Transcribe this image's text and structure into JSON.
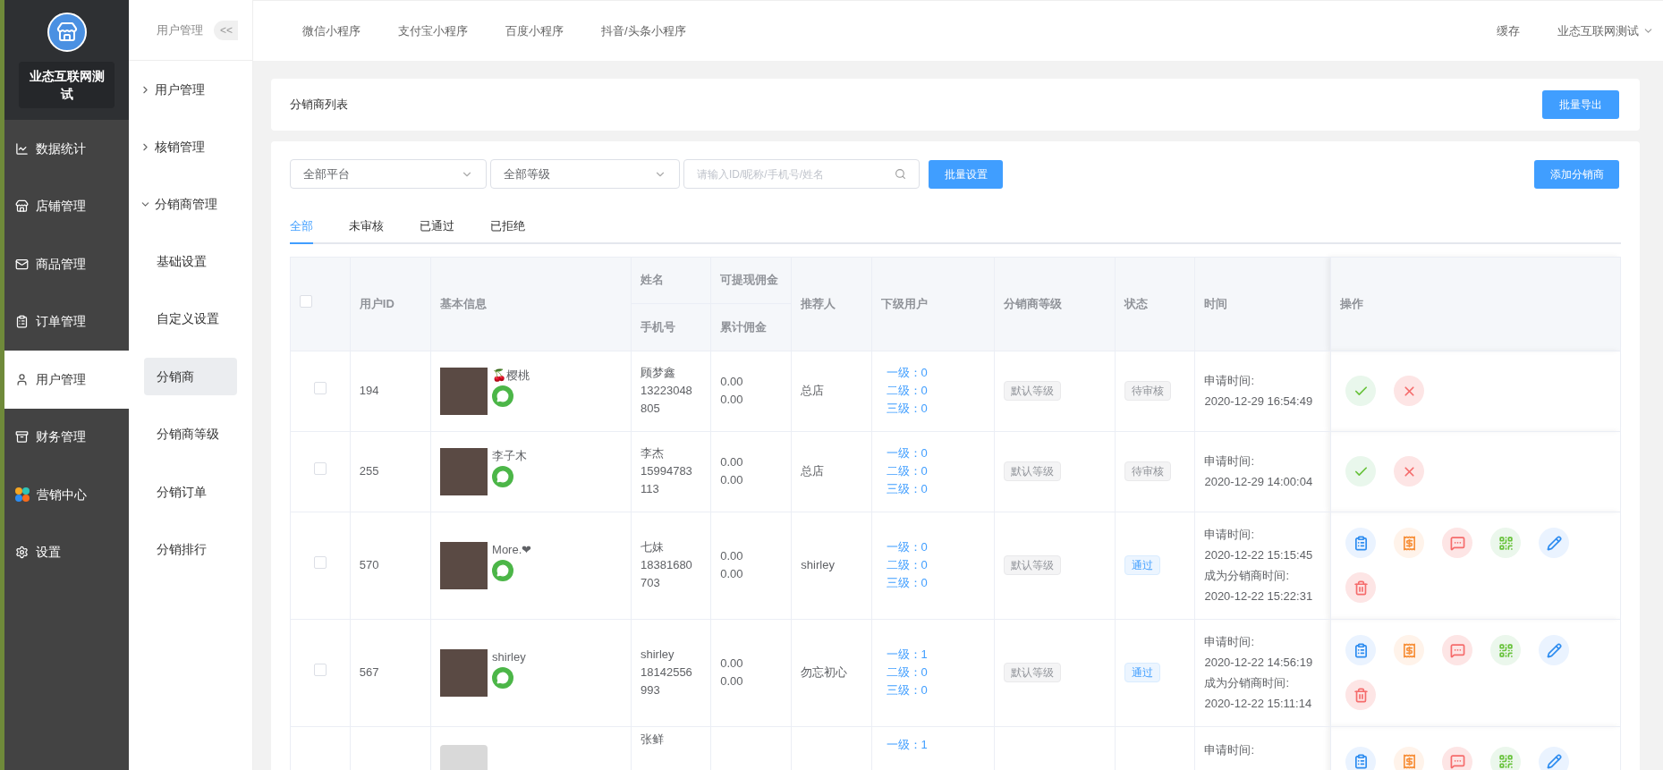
{
  "brand": {
    "name": "业态互联网测试"
  },
  "main_menu": [
    {
      "label": "数据统计",
      "selected": false
    },
    {
      "label": "店铺管理",
      "selected": false
    },
    {
      "label": "商品管理",
      "selected": false
    },
    {
      "label": "订单管理",
      "selected": false
    },
    {
      "label": "用户管理",
      "selected": true
    },
    {
      "label": "财务管理",
      "selected": false
    },
    {
      "label": "营销中心",
      "selected": false
    },
    {
      "label": "设置",
      "selected": false
    }
  ],
  "sub_header": {
    "title": "用户管理",
    "collapse": "<<"
  },
  "sub_menu": [
    {
      "label": "用户管理",
      "expanded": false
    },
    {
      "label": "核销管理",
      "expanded": false
    },
    {
      "label": "分销商管理",
      "expanded": true,
      "children": [
        {
          "label": "基础设置",
          "selected": false
        },
        {
          "label": "自定义设置",
          "selected": false
        },
        {
          "label": "分销商",
          "selected": true
        },
        {
          "label": "分销商等级",
          "selected": false
        },
        {
          "label": "分销订单",
          "selected": false
        },
        {
          "label": "分销排行",
          "selected": false
        }
      ]
    }
  ],
  "top_tabs": [
    "微信小程序",
    "支付宝小程序",
    "百度小程序",
    "抖音/头条小程序"
  ],
  "top_right": {
    "cache": "缓存",
    "user": "业态互联网测试"
  },
  "list_header": {
    "title": "分销商列表",
    "export_button": "批量导出"
  },
  "filters": {
    "platform": "全部平台",
    "level": "全部等级",
    "search_placeholder": "请输入ID/昵称/手机号/姓名",
    "batch_button": "批量设置",
    "add_button": "添加分销商"
  },
  "status_tabs": [
    {
      "label": "全部",
      "selected": true
    },
    {
      "label": "未审核",
      "selected": false
    },
    {
      "label": "已通过",
      "selected": false
    },
    {
      "label": "已拒绝",
      "selected": false
    }
  ],
  "table": {
    "select_all": {
      "checked": false
    },
    "columns": {
      "id": "用户ID",
      "info": "基本信息",
      "name": "姓名",
      "phone": "手机号",
      "withdrawable": "可提现佣金",
      "total": "累计佣金",
      "referrer": "推荐人",
      "subs": "下级用户",
      "level": "分销商等级",
      "status": "状态",
      "time": "时间",
      "actions": "操作"
    },
    "rows": [
      {
        "checked": false,
        "id": "194",
        "nickname": "🍒樱桃",
        "name": "顾梦鑫",
        "phone": "13223048805",
        "withdrawable": "0.00",
        "total": "0.00",
        "referrer": "总店",
        "subs": [
          "一级：0",
          "二级：0",
          "三级：0"
        ],
        "level": "默认等级",
        "status": {
          "label": "待审核",
          "kind": "pending"
        },
        "times": [
          "申请时间:",
          "2020-12-29 16:54:49"
        ],
        "kind": "review"
      },
      {
        "checked": false,
        "id": "255",
        "nickname": "李子木",
        "name": "李杰",
        "phone": "15994783113",
        "withdrawable": "0.00",
        "total": "0.00",
        "referrer": "总店",
        "subs": [
          "一级：0",
          "二级：0",
          "三级：0"
        ],
        "level": "默认等级",
        "status": {
          "label": "待审核",
          "kind": "pending"
        },
        "times": [
          "申请时间:",
          "2020-12-29 14:00:04"
        ],
        "kind": "review"
      },
      {
        "checked": false,
        "id": "570",
        "nickname": "More.❤",
        "name": "七妹",
        "phone": "18381680703",
        "withdrawable": "0.00",
        "total": "0.00",
        "referrer": "shirley",
        "subs": [
          "一级：0",
          "二级：0",
          "三级：0"
        ],
        "level": "默认等级",
        "status": {
          "label": "通过",
          "kind": "passed"
        },
        "times": [
          "申请时间:",
          "2020-12-22 15:15:45",
          "成为分销商时间:",
          "2020-12-22 15:22:31"
        ],
        "kind": "manage"
      },
      {
        "checked": false,
        "id": "567",
        "nickname": "shirley",
        "name": "shirley",
        "phone": "18142556993",
        "withdrawable": "0.00",
        "total": "0.00",
        "referrer": "勿忘初心",
        "subs": [
          "一级：1",
          "二级：0",
          "三级：0"
        ],
        "level": "默认等级",
        "status": {
          "label": "通过",
          "kind": "passed"
        },
        "times": [
          "申请时间:",
          "2020-12-22 14:56:19",
          "成为分销商时间:",
          "2020-12-22 15:11:14"
        ],
        "kind": "manage"
      },
      {
        "name": "张鲜",
        "subs": [
          "一级：1"
        ],
        "times": [
          "申请时间:"
        ],
        "kind": "manage"
      }
    ]
  }
}
